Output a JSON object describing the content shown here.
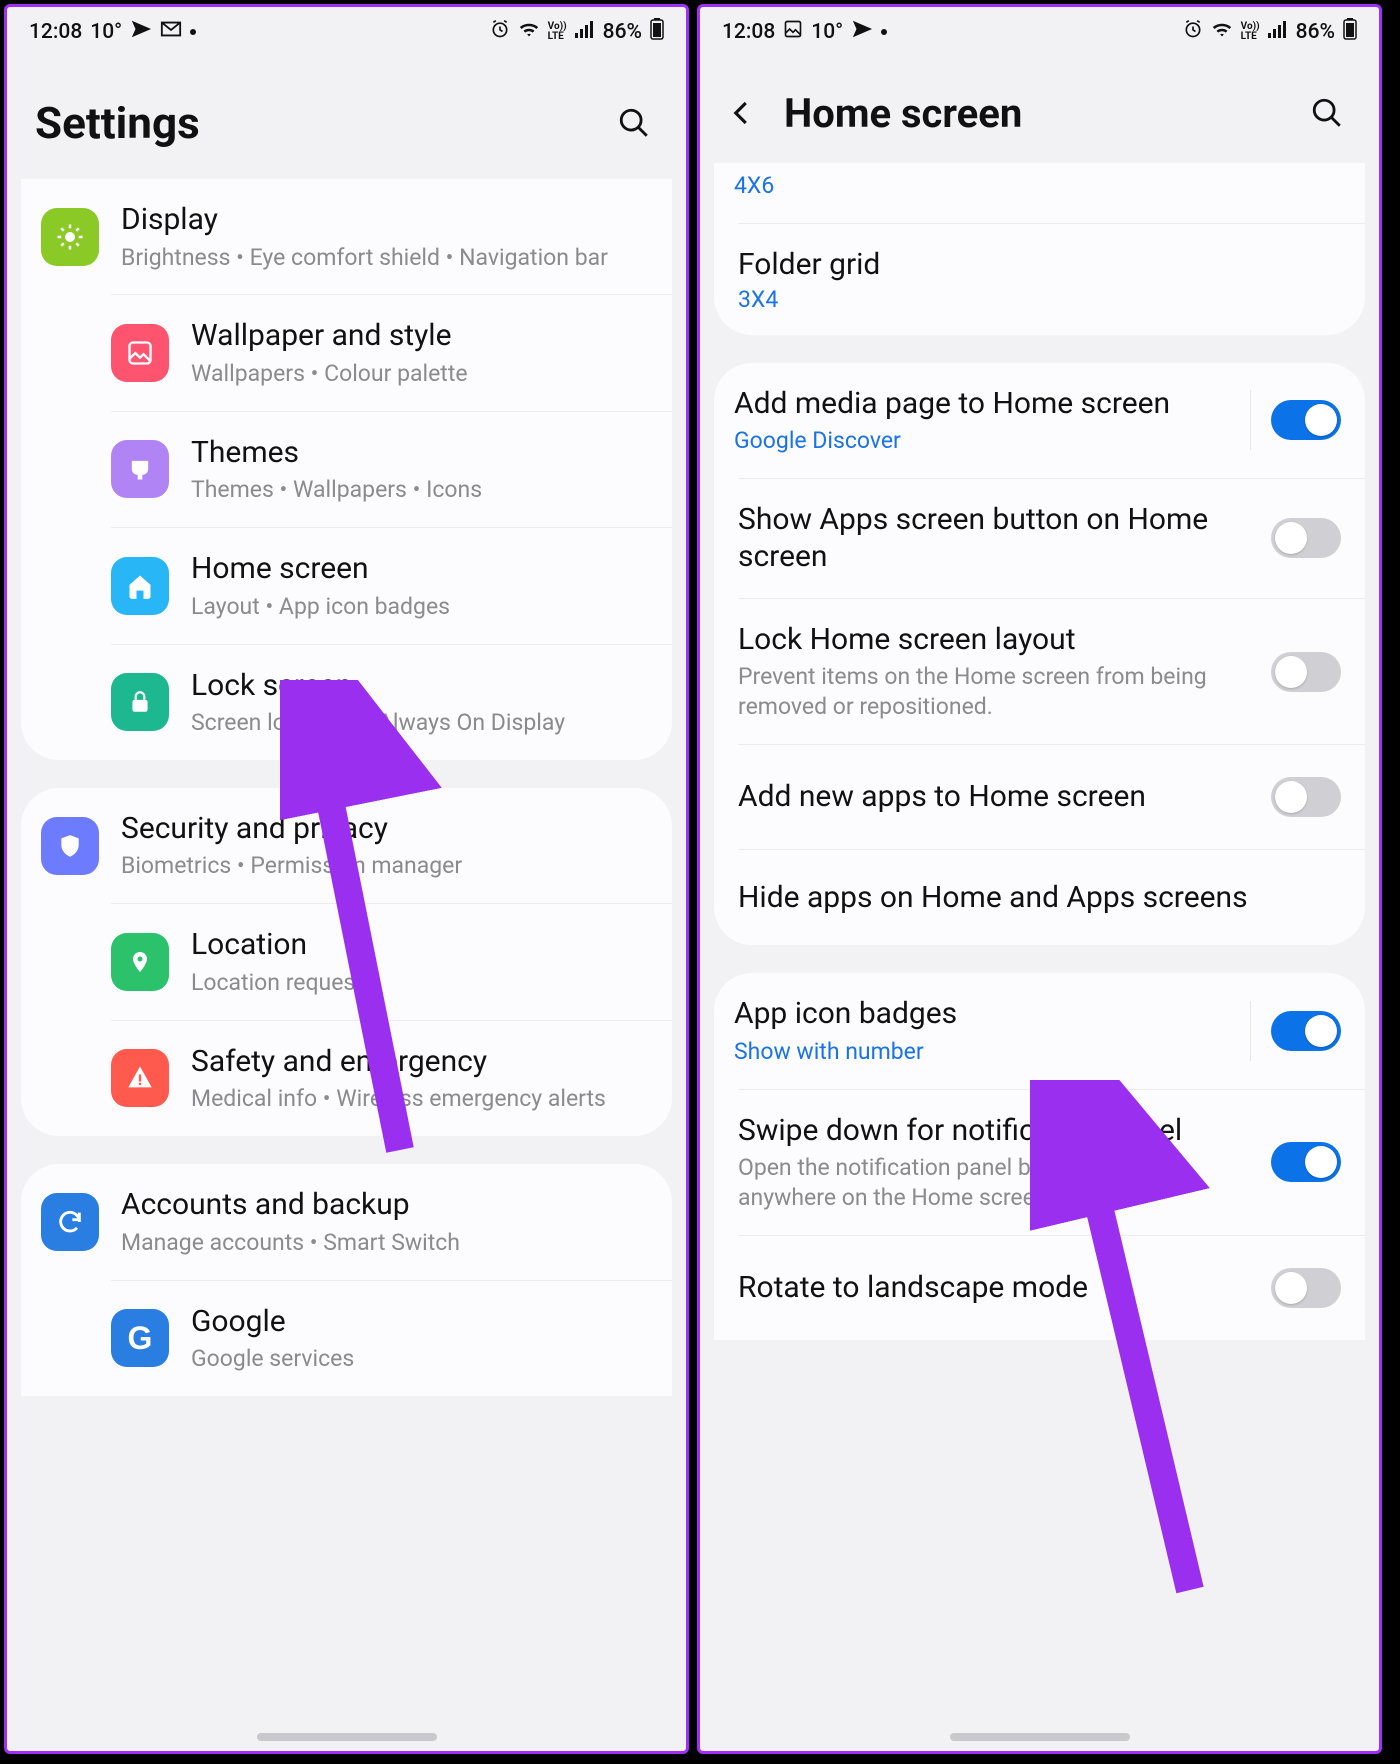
{
  "status": {
    "time": "12:08",
    "temp": "10°",
    "battery": "86%"
  },
  "left": {
    "title": "Settings",
    "items": {
      "display": {
        "title": "Display",
        "sub": "Brightness  •  Eye comfort shield  •  Navigation bar"
      },
      "wallpaper": {
        "title": "Wallpaper and style",
        "sub": "Wallpapers  •  Colour palette"
      },
      "themes": {
        "title": "Themes",
        "sub": "Themes  •  Wallpapers  •  Icons"
      },
      "home": {
        "title": "Home screen",
        "sub": "Layout  •  App icon badges"
      },
      "lock": {
        "title": "Lock screen",
        "sub": "Screen lock type  •  Always On Display"
      },
      "security": {
        "title": "Security and privacy",
        "sub": "Biometrics  •  Permission manager"
      },
      "location": {
        "title": "Location",
        "sub": "Location requests"
      },
      "safety": {
        "title": "Safety and emergency",
        "sub": "Medical info  •  Wireless emergency alerts"
      },
      "accounts": {
        "title": "Accounts and backup",
        "sub": "Manage accounts  •  Smart Switch"
      },
      "google": {
        "title": "Google",
        "sub": "Google services"
      }
    }
  },
  "right": {
    "title": "Home screen",
    "grid_value": "4X6",
    "folder": {
      "title": "Folder grid",
      "value": "3X4"
    },
    "media": {
      "title": "Add media page to Home screen",
      "sub": "Google Discover",
      "on": true
    },
    "appsbtn": {
      "title": "Show Apps screen button on Home screen",
      "on": false
    },
    "lock": {
      "title": "Lock Home screen layout",
      "sub": "Prevent items on the Home screen from being removed or repositioned.",
      "on": false
    },
    "addnew": {
      "title": "Add new apps to Home screen",
      "on": false
    },
    "hide": {
      "title": "Hide apps on Home and Apps screens"
    },
    "badges": {
      "title": "App icon badges",
      "sub": "Show with number",
      "on": true
    },
    "swipe": {
      "title": "Swipe down for notification panel",
      "sub": "Open the notification panel by swiping down anywhere on the Home screen.",
      "on": true
    },
    "rotate": {
      "title": "Rotate to landscape mode",
      "on": false
    }
  },
  "colors": {
    "display": "#8ac926",
    "wallpaper": "#ff5470",
    "themes": "#b084f5",
    "home": "#29b6f6",
    "lock": "#1db890",
    "security": "#6d7cff",
    "location": "#2bc26b",
    "safety": "#ff5a4d",
    "accounts": "#2a7de1",
    "google": "#2a7de1"
  }
}
